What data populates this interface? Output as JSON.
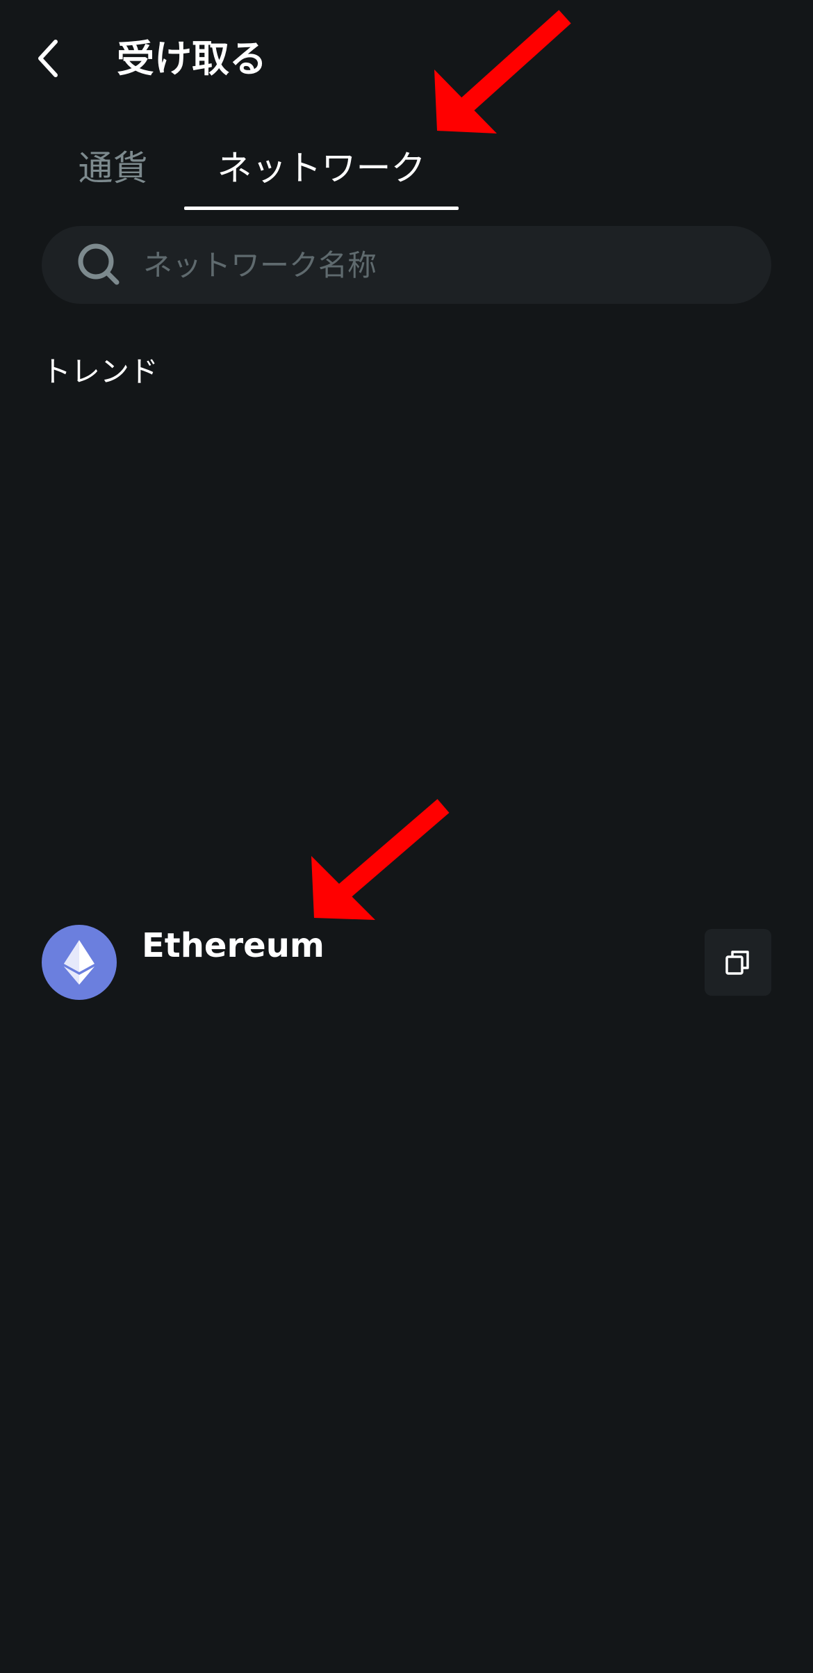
{
  "header": {
    "title": "受け取る",
    "back_icon": "chevron-left-icon"
  },
  "tabs": [
    {
      "label": "通貨",
      "active": false
    },
    {
      "label": "ネットワーク",
      "active": true
    }
  ],
  "search": {
    "placeholder": "ネットワーク名称",
    "value": "",
    "icon": "search-icon"
  },
  "section": {
    "label": "トレンド"
  },
  "networks": [
    {
      "name": "Ethereum",
      "logo_icon": "ethereum-icon",
      "logo_color": "#6b7fde",
      "action_icon": "copy-icon"
    }
  ],
  "colors": {
    "background": "#131618",
    "surface": "#1d2124",
    "text_primary": "#ffffff",
    "text_inactive": "#7d8a8e",
    "placeholder": "#5f6a6e",
    "annotation": "#ff0000"
  }
}
